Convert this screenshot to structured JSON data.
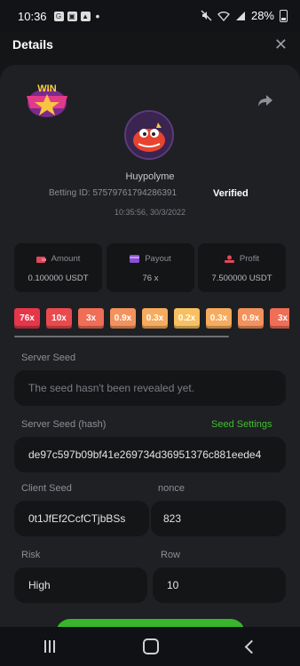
{
  "status_bar": {
    "time": "10:36",
    "battery": "28%"
  },
  "header": {
    "title": "Details",
    "close": "✕"
  },
  "badge": {
    "text": "WIN"
  },
  "player": {
    "username": "Huypolyme",
    "betting_id": "Betting ID: 57579761794286391",
    "verified": "Verified",
    "timestamp": "10:35:56, 30/3/2022"
  },
  "stats": [
    {
      "label": "Amount",
      "value": "0.100000 USDT",
      "icon": "wallet-icon"
    },
    {
      "label": "Payout",
      "value": "76 x",
      "icon": "card-icon"
    },
    {
      "label": "Profit",
      "value": "7.500000 USDT",
      "icon": "money-hand-icon"
    }
  ],
  "multipliers": [
    {
      "label": "76x",
      "color": "#e5364a"
    },
    {
      "label": "10x",
      "color": "#ea4a4e"
    },
    {
      "label": "3x",
      "color": "#f06d56"
    },
    {
      "label": "0.9x",
      "color": "#f3925c"
    },
    {
      "label": "0.3x",
      "color": "#f6ab5e"
    },
    {
      "label": "0.2x",
      "color": "#f8c061"
    },
    {
      "label": "0.3x",
      "color": "#f6ab5e"
    },
    {
      "label": "0.9x",
      "color": "#f3925c"
    },
    {
      "label": "3x",
      "color": "#f06d56"
    }
  ],
  "server_seed": {
    "label": "Server Seed",
    "placeholder": "The seed hasn't been revealed yet."
  },
  "server_seed_hash": {
    "label": "Server Seed (hash)",
    "link": "Seed Settings",
    "value": "de97c597b09bf41e269734d36951376c881eede4"
  },
  "client_seed": {
    "label": "Client Seed",
    "value": "0t1JfEf2CcfCTjbBSs"
  },
  "nonce": {
    "label": "nonce",
    "value": "823"
  },
  "risk": {
    "label": "Risk",
    "value": "High"
  },
  "row": {
    "label": "Row",
    "value": "10"
  },
  "colors": {
    "accent_green": "#39b52c",
    "panel_bg": "#1f2023",
    "field_bg": "#141517"
  }
}
